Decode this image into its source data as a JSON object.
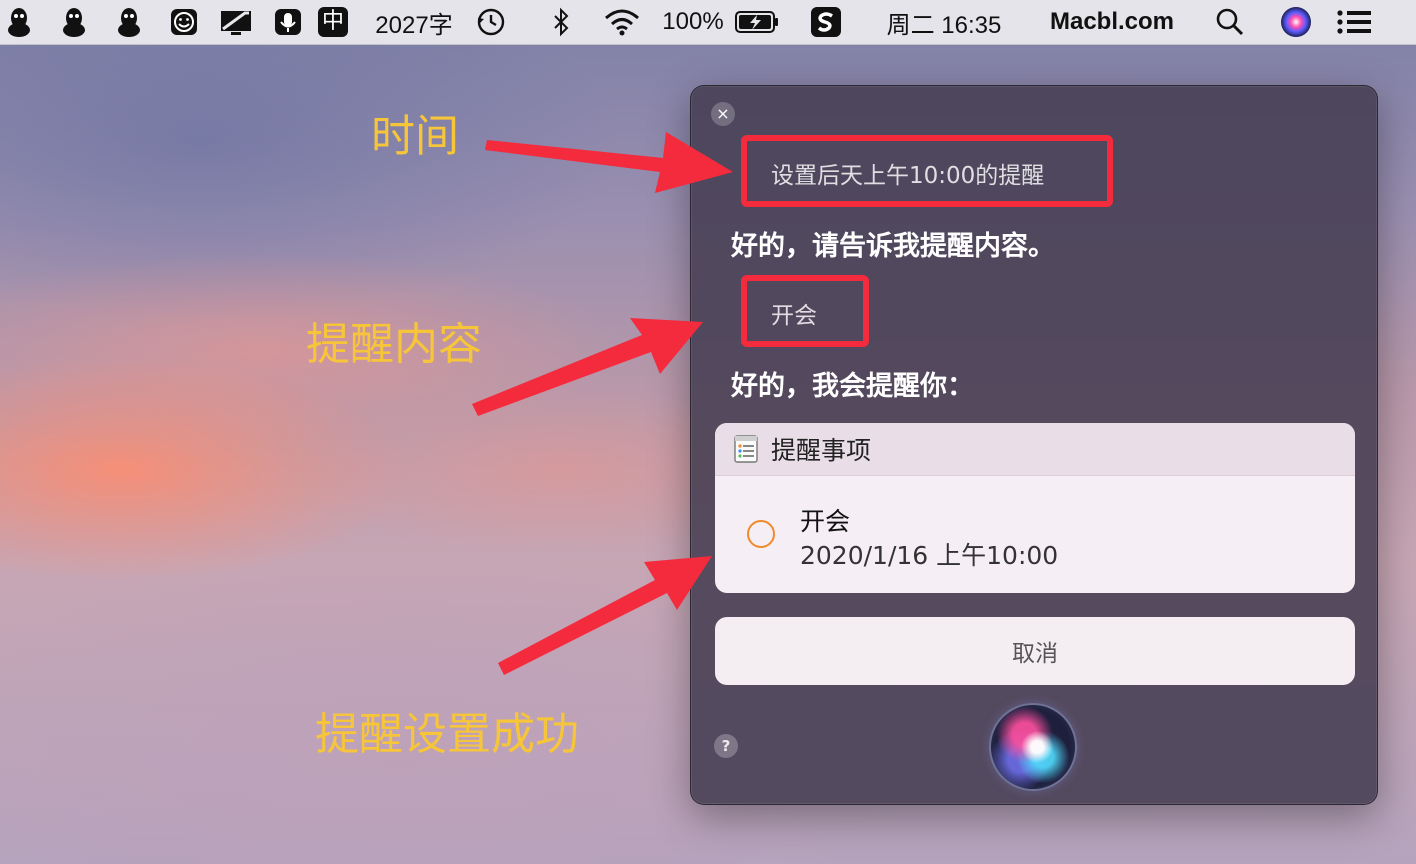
{
  "menubar": {
    "word_count": "2027字",
    "input_method": "中",
    "battery": "100%",
    "clock": "周二 16:35",
    "site": "Macbl.com",
    "icons": [
      "qq-icon",
      "qq-icon",
      "qq-icon",
      "emoji-icon",
      "display-icon",
      "microphone-icon",
      "input-method-icon",
      "time-machine-icon",
      "bluetooth-icon",
      "wifi-icon",
      "battery-charging-icon",
      "sogou-icon",
      "spotlight-search-icon",
      "siri-icon",
      "notification-center-icon"
    ]
  },
  "siri": {
    "close_glyph": "×",
    "query1": "设置后天上午10:00的提醒",
    "reply1": "好的，请告诉我提醒内容。",
    "query2": "开会",
    "reply2": "好的，我会提醒你：",
    "card": {
      "app_name": "提醒事项",
      "reminder_title": "开会",
      "reminder_datetime": "2020/1/16 上午10:00"
    },
    "cancel_label": "取消",
    "help_glyph": "?"
  },
  "annotations": {
    "time_label": "时间",
    "content_label": "提醒内容",
    "success_label": "提醒设置成功",
    "highlight_color": "#f42a3d",
    "label_color": "#f7c53a"
  }
}
